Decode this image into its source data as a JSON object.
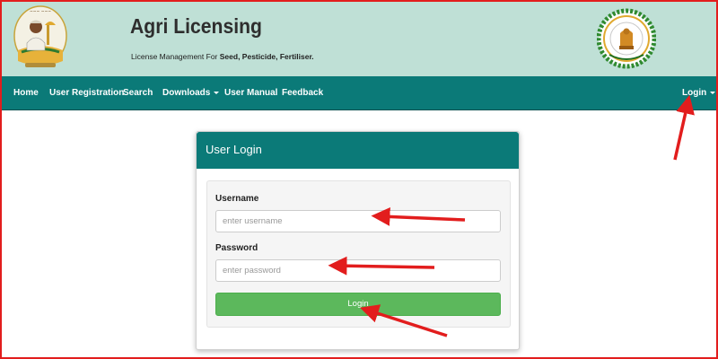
{
  "header": {
    "title": "Agri Licensing",
    "tagline_prefix": "License Management For",
    "tagline_items": "Seed, Pesticide, Fertiliser."
  },
  "navbar": {
    "items": [
      {
        "label": "Home"
      },
      {
        "label": "User Registration"
      },
      {
        "label": "Search"
      },
      {
        "label": "Downloads"
      },
      {
        "label": "User Manual"
      },
      {
        "label": "Feedback"
      }
    ],
    "login_label": "Login"
  },
  "login_panel": {
    "title": "User Login",
    "username_label": "Username",
    "username_placeholder": "enter username",
    "password_label": "Password",
    "password_placeholder": "enter password",
    "submit_label": "Login"
  },
  "colors": {
    "header_bg": "#bfe0d6",
    "nav_bg": "#0b7a78",
    "button_bg": "#5cb85c",
    "annotation": "#e21d1d"
  },
  "icons": [
    "farmer-logo-icon",
    "state-emblem-icon",
    "caret-down-icon",
    "annotation-arrow-icon"
  ]
}
